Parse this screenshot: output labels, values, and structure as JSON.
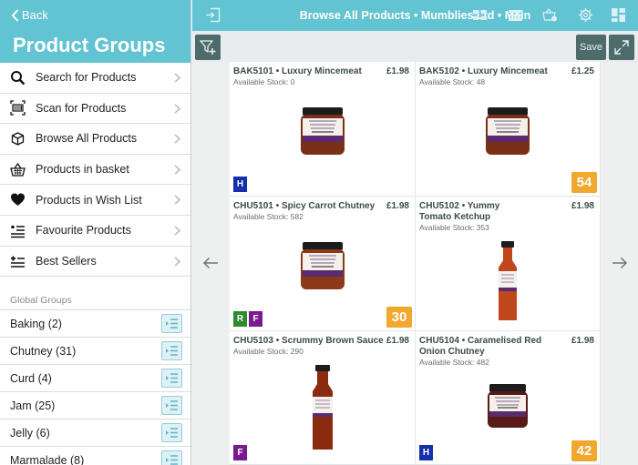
{
  "sidebar": {
    "back_label": "Back",
    "title": "Product Groups",
    "nav_items": [
      {
        "label": "Search for Products",
        "icon": "search-icon"
      },
      {
        "label": "Scan for Products",
        "icon": "barcode-scan-icon"
      },
      {
        "label": "Browse All Products",
        "icon": "box-icon"
      },
      {
        "label": "Products in basket",
        "icon": "basket-icon"
      },
      {
        "label": "Products in Wish List",
        "icon": "heart-icon"
      },
      {
        "label": "Favourite Products",
        "icon": "favourite-list-icon"
      },
      {
        "label": "Best Sellers",
        "icon": "best-sellers-icon"
      }
    ],
    "global_heading": "Global Groups",
    "groups": [
      {
        "label": "Baking (2)"
      },
      {
        "label": "Chutney (31)"
      },
      {
        "label": "Curd (4)"
      },
      {
        "label": "Jam (25)"
      },
      {
        "label": "Jelly (6)"
      },
      {
        "label": "Marmalade (8)"
      }
    ]
  },
  "topbar": {
    "title": "Browse All Products • Mumblies Ltd • Main",
    "icons": [
      "exit-icon",
      "grid-view-icon",
      "list-view-icon",
      "basket-settings-icon",
      "gear-icon",
      "dashboard-icon"
    ]
  },
  "toolbar": {
    "save_label": "Save",
    "filter_icon": "filter-add-icon",
    "expand_icon": "expand-icon"
  },
  "colors": {
    "accent": "#62c3d2",
    "toolbar_button": "#4e6b6b",
    "qty_badge": "#f0a82e",
    "flag_H": "#1530a8",
    "flag_R": "#2d8a2d",
    "flag_F": "#7b1a8e"
  },
  "products": [
    {
      "title": "BAK5101 • Luxury Mincemeat",
      "price": "£1.98",
      "stock": "Available Stock: 0",
      "image": "jar",
      "jar_label": "Luxury Mincemeat",
      "flags": [
        "H"
      ],
      "qty": ""
    },
    {
      "title": "BAK5102 • Luxury Mincemeat",
      "price": "£1.25",
      "stock": "Available Stock: 48",
      "image": "jar",
      "jar_label": "Luxury Mincemeat",
      "flags": [],
      "qty": "54"
    },
    {
      "title": "CHU5101 • Spicy Carrot Chutney",
      "price": "£1.98",
      "stock": "Available Stock: 582",
      "image": "jar",
      "jar_label": "Spicy Carrot Chutney",
      "flags": [
        "R",
        "F"
      ],
      "qty": "30"
    },
    {
      "title": "CHU5102 • Yummy Tomato Ketchup",
      "price": "£1.98",
      "stock": "Available Stock: 353",
      "image": "bottle",
      "jar_label": "Yummy Tomato Ketchup",
      "flags": [],
      "qty": ""
    },
    {
      "title": "CHU5103 • Scrummy Brown Sauce",
      "price": "£1.98",
      "stock": "Available Stock: 290",
      "image": "bottle",
      "jar_label": "Scrummy Brown Sauce",
      "flags": [
        "F"
      ],
      "qty": ""
    },
    {
      "title": "CHU5104 • Caramelised Red Onion Chutney",
      "price": "£1.98",
      "stock": "Available Stock: 482",
      "image": "jar",
      "jar_label": "Caramelised Red Onion Chutney",
      "flags": [
        "H"
      ],
      "qty": "42"
    }
  ],
  "navigation": {
    "prev_icon": "arrow-left-icon",
    "next_icon": "arrow-right-icon"
  }
}
